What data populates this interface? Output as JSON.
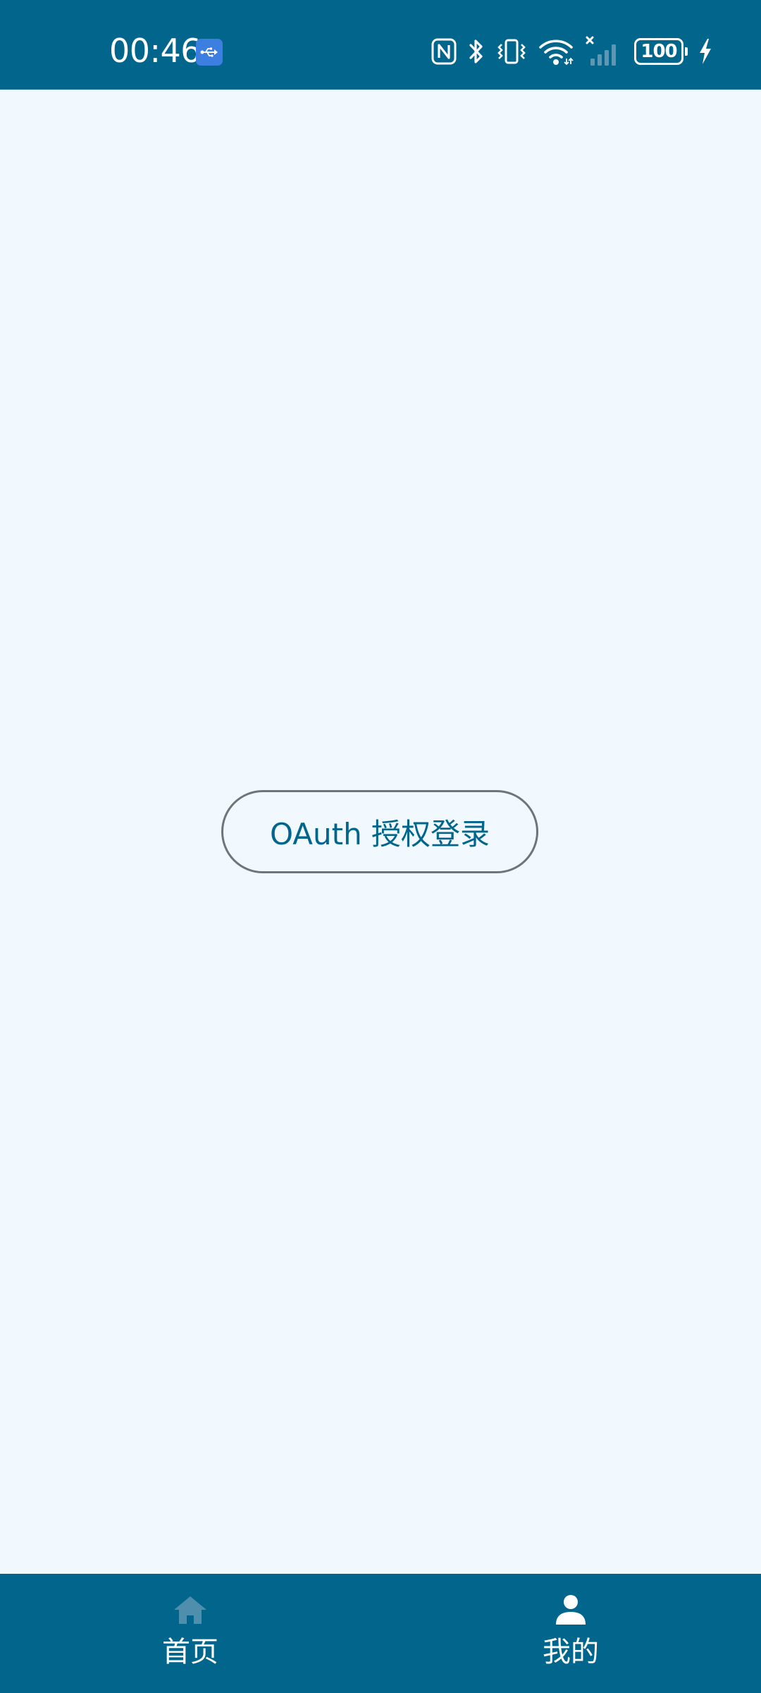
{
  "status_bar": {
    "time": "00:46",
    "battery_level": "100",
    "background_color": "#01658C",
    "icons": [
      "usb-icon",
      "nfc-icon",
      "bluetooth-icon",
      "vibrate-icon",
      "wifi-icon",
      "signal-no-service-icon",
      "battery-icon",
      "charging-icon"
    ]
  },
  "main": {
    "background_color": "#F2F9FE",
    "oauth_button_label": "OAuth 授权登录",
    "accent_color": "#01658C"
  },
  "bottom_nav": {
    "background_color": "#01658C",
    "items": [
      {
        "label": "首页",
        "icon": "home-icon",
        "selected": false
      },
      {
        "label": "我的",
        "icon": "person-icon",
        "selected": true
      }
    ]
  }
}
